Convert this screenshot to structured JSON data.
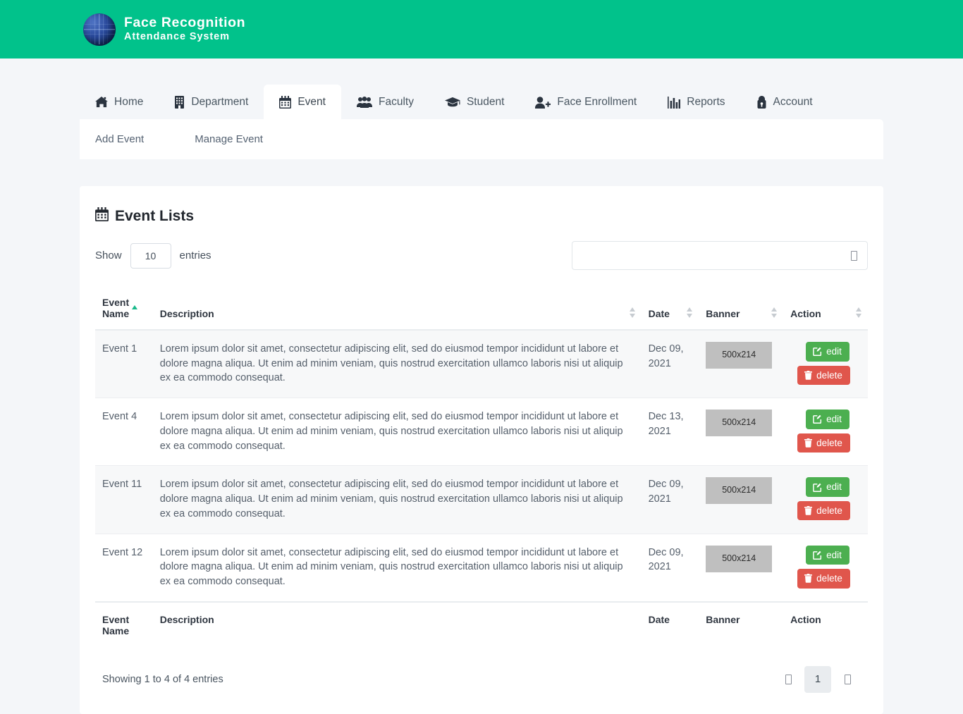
{
  "brand": {
    "logo_icon": "globe-icon",
    "line1": "Face Recognition",
    "line2": "Attendance System",
    "bar_color": "#01c28b"
  },
  "nav": {
    "tabs": [
      {
        "label": "Home",
        "icon": "home-icon",
        "active": false
      },
      {
        "label": "Department",
        "icon": "building-icon",
        "active": false
      },
      {
        "label": "Event",
        "icon": "calendar-icon",
        "active": true
      },
      {
        "label": "Faculty",
        "icon": "users-icon",
        "active": false
      },
      {
        "label": "Student",
        "icon": "graduation-cap-icon",
        "active": false
      },
      {
        "label": "Face Enrollment",
        "icon": "user-plus-icon",
        "active": false
      },
      {
        "label": "Reports",
        "icon": "bar-chart-icon",
        "active": false
      },
      {
        "label": "Account",
        "icon": "user-lock-icon",
        "active": false
      }
    ],
    "subnav": [
      {
        "label": "Add Event"
      },
      {
        "label": "Manage Event"
      }
    ]
  },
  "card": {
    "title": "Event Lists",
    "title_icon": "calendar-icon"
  },
  "controls": {
    "show_label": "Show",
    "entries_label": "entries",
    "page_length": "10",
    "search_placeholder": "",
    "search_value": "",
    "search_icon": "missing-glyph-box"
  },
  "table": {
    "columns": [
      {
        "label": "Event Name",
        "sort": "asc"
      },
      {
        "label": "Description",
        "sort": "none"
      },
      {
        "label": "Date",
        "sort": "none"
      },
      {
        "label": "Banner",
        "sort": "none"
      },
      {
        "label": "Action",
        "sort": "none"
      }
    ],
    "footer_columns": [
      "Event Name",
      "Description",
      "Date",
      "Banner",
      "Action"
    ],
    "rows": [
      {
        "name": "Event 1",
        "description": "Lorem ipsum dolor sit amet, consectetur adipiscing elit, sed do eiusmod tempor incididunt ut labore et dolore magna aliqua. Ut enim ad minim veniam, quis nostrud exercitation ullamco laboris nisi ut aliquip ex ea commodo consequat.",
        "date": "Dec 09, 2021",
        "banner": "500x214",
        "edit_label": "edit",
        "delete_label": "delete"
      },
      {
        "name": "Event 4",
        "description": "Lorem ipsum dolor sit amet, consectetur adipiscing elit, sed do eiusmod tempor incididunt ut labore et dolore magna aliqua. Ut enim ad minim veniam, quis nostrud exercitation ullamco laboris nisi ut aliquip ex ea commodo consequat.",
        "date": "Dec 13, 2021",
        "banner": "500x214",
        "edit_label": "edit",
        "delete_label": "delete"
      },
      {
        "name": "Event 11",
        "description": "Lorem ipsum dolor sit amet, consectetur adipiscing elit, sed do eiusmod tempor incididunt ut labore et dolore magna aliqua. Ut enim ad minim veniam, quis nostrud exercitation ullamco laboris nisi ut aliquip ex ea commodo consequat.",
        "date": "Dec 09, 2021",
        "banner": "500x214",
        "edit_label": "edit",
        "delete_label": "delete"
      },
      {
        "name": "Event 12",
        "description": "Lorem ipsum dolor sit amet, consectetur adipiscing elit, sed do eiusmod tempor incididunt ut labore et dolore magna aliqua. Ut enim ad minim veniam, quis nostrud exercitation ullamco laboris nisi ut aliquip ex ea commodo consequat.",
        "date": "Dec 09, 2021",
        "banner": "500x214",
        "edit_label": "edit",
        "delete_label": "delete"
      }
    ]
  },
  "footer": {
    "info": "Showing 1 to 4 of 4 entries",
    "pagination": [
      {
        "label": "",
        "icon": "missing-glyph-box",
        "name": "previous",
        "active": false
      },
      {
        "label": "1",
        "icon": "",
        "name": "page-1",
        "active": true
      },
      {
        "label": "",
        "icon": "missing-glyph-box",
        "name": "next",
        "active": false
      }
    ]
  },
  "colors": {
    "brand_green": "#01c28b",
    "edit_green": "#4caf50",
    "delete_red": "#e0564c",
    "sort_active": "#18b98a",
    "page_bg": "#f4f6f9",
    "banner_placeholder": "#bfbfbf"
  }
}
